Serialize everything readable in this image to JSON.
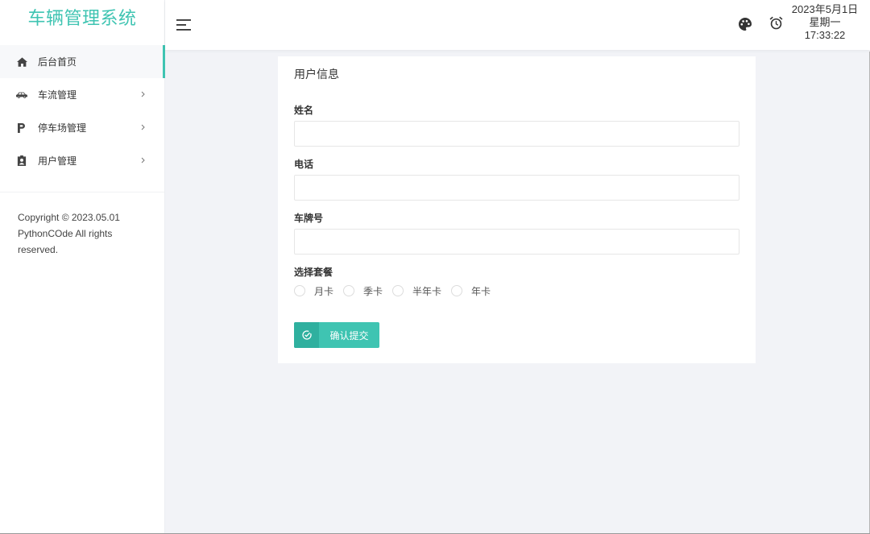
{
  "app": {
    "title": "车辆管理系统"
  },
  "colors": {
    "accent": "#3fc4b2",
    "accent_dark": "#2fb09f",
    "page_bg": "#f2f3f7"
  },
  "sidebar": {
    "items": [
      {
        "label": "后台首页",
        "icon": "home-icon",
        "active": true,
        "has_submenu": false
      },
      {
        "label": "车流管理",
        "icon": "car-icon",
        "active": false,
        "has_submenu": true
      },
      {
        "label": "停车场管理",
        "icon": "parking-icon",
        "active": false,
        "has_submenu": true
      },
      {
        "label": "用户管理",
        "icon": "user-badge-icon",
        "active": false,
        "has_submenu": true
      }
    ],
    "copyright": {
      "line1": "Copyright © 2023.05.01",
      "line2": "PythonCOde All rights",
      "line3": "reserved."
    }
  },
  "header": {
    "menu_toggle_icon": "hamburger-icon",
    "theme_icon": "palette-icon",
    "alarm_icon": "alarm-clock-icon",
    "date": "2023年5月1日",
    "weekday": "星期一",
    "time": "17:33:22"
  },
  "form": {
    "title": "用户信息",
    "fields": [
      {
        "label": "姓名",
        "value": ""
      },
      {
        "label": "电话",
        "value": ""
      },
      {
        "label": "车牌号",
        "value": ""
      }
    ],
    "package": {
      "label": "选择套餐",
      "options": [
        "月卡",
        "季卡",
        "半年卡",
        "年卡"
      ],
      "selected": null
    },
    "submit": {
      "label": "确认提交",
      "icon": "check-circle-icon"
    }
  }
}
